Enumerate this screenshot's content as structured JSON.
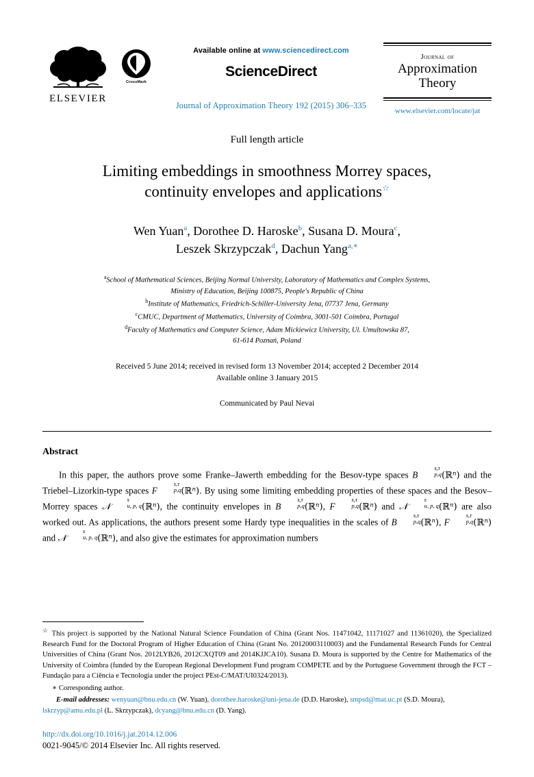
{
  "masthead": {
    "publisher_name": "ELSEVIER",
    "crossmark_label": "CrossMark",
    "available_prefix": "Available online at ",
    "sciencedirect_url": "www.sciencedirect.com",
    "sciencedirect_logo": "ScienceDirect",
    "journal_reference": "Journal of Approximation Theory 192 (2015) 306–335",
    "journal_title_small": "Journal of",
    "journal_title_line1": "Approximation",
    "journal_title_line2": "Theory",
    "journal_url": "www.elsevier.com/locate/jat"
  },
  "article": {
    "type": "Full length article",
    "title_line1": "Limiting embeddings in smoothness Morrey spaces,",
    "title_line2": "continuity envelopes and applications",
    "title_footnote_mark": "☆",
    "authors_line1": [
      {
        "name": "Wen Yuan",
        "marks": "a",
        "sep": ", "
      },
      {
        "name": "Dorothee D. Haroske",
        "marks": "b",
        "sep": ", "
      },
      {
        "name": "Susana D. Moura",
        "marks": "c",
        "sep": ","
      }
    ],
    "authors_line2": [
      {
        "name": "Leszek Skrzypczak",
        "marks": "d",
        "sep": ", "
      },
      {
        "name": "Dachun Yang",
        "marks": "a",
        "corresponding": ",∗",
        "sep": ""
      }
    ],
    "affiliations": [
      {
        "mark": "a",
        "line1": "School of Mathematical Sciences, Beijing Normal University, Laboratory of Mathematics and Complex Systems,",
        "line2": "Ministry of Education, Beijing 100875, People's Republic of China"
      },
      {
        "mark": "b",
        "line1": "Institute of Mathematics, Friedrich-Schiller-University Jena, 07737 Jena, Germany",
        "line2": ""
      },
      {
        "mark": "c",
        "line1": "CMUC, Department of Mathematics, University of Coimbra, 3001-501 Coimbra, Portugal",
        "line2": ""
      },
      {
        "mark": "d",
        "line1": "Faculty of Mathematics and Computer Science, Adam Mickiewicz University, Ul. Umultowska 87,",
        "line2": "61-614 Poznań, Poland"
      }
    ],
    "received_line": "Received 5 June 2014; received in revised form 13 November 2014; accepted 2 December 2014",
    "available_line": "Available online 3 January 2015",
    "communicated": "Communicated by Paul Nevai"
  },
  "abstract": {
    "heading": "Abstract",
    "t1": "In this paper, the authors prove some Franke–Jawerth embedding for the Besov-type spaces ",
    "t2": " and the Triebel–Lizorkin-type spaces ",
    "t3": ". By using some limiting embedding properties of these spaces and the Besov–Morrey spaces ",
    "t4": ", the continuity envelopes in ",
    "t5": ", ",
    "t6": " and ",
    "t7": " are also worked out. As applications, the authors present some Hardy type inequalities in the scales of ",
    "t8": ", ",
    "t9": " and ",
    "t10": ", and also give the estimates for approximation numbers"
  },
  "math": {
    "B": "B",
    "F": "F",
    "N": "𝒩",
    "sup_stau": "s,τ",
    "sub_pq": "p,q",
    "sup_s": "s",
    "sub_upq": "u, p, q",
    "domain": "(ℝ",
    "domain_exp": "n",
    "domain_close": ")"
  },
  "footnotes": {
    "funding_mark": "☆",
    "funding_text": "This project is supported by the National Natural Science Foundation of China (Grant Nos. 11471042, 11171027 and 11361020), the Specialized Research Fund for the Doctoral Program of Higher Education of China (Grant No. 20120003110003) and the Fundamental Research Funds for Central Universities of China (Grant Nos. 2012LYB26, 2012CXQT09 and 2014KJJCA10). Susana D. Moura is supported by the Centre for Mathematics of the University of Coimbra (funded by the European Regional Development Fund program COMPETE and by the Portuguese Government through the FCT – Fundação para a Ciência e Tecnologia under the project PEst-C/MAT/UI0324/2013).",
    "corresponding_mark": "∗",
    "corresponding_text": "Corresponding author.",
    "email_label": "E-mail addresses:",
    "emails": [
      {
        "address": "wenyuan@bnu.edu.cn",
        "owner": "(W. Yuan)"
      },
      {
        "address": "dorothee.haroske@uni-jena.de",
        "owner": "(D.D. Haroske)"
      },
      {
        "address": "smpsd@mat.uc.pt",
        "owner": "(S.D. Moura)"
      },
      {
        "address": "lskrzyp@amu.edu.pl",
        "owner": "(L. Skrzypczak)"
      },
      {
        "address": "dcyang@bnu.edu.cn",
        "owner": "(D. Yang)."
      }
    ]
  },
  "bottom": {
    "doi": "http://dx.doi.org/10.1016/j.jat.2014.12.006",
    "copyright": "0021-9045/© 2014 Elsevier Inc. All rights reserved."
  },
  "colors": {
    "link": "#1f7bb6",
    "text": "#000000",
    "background": "#ffffff"
  }
}
